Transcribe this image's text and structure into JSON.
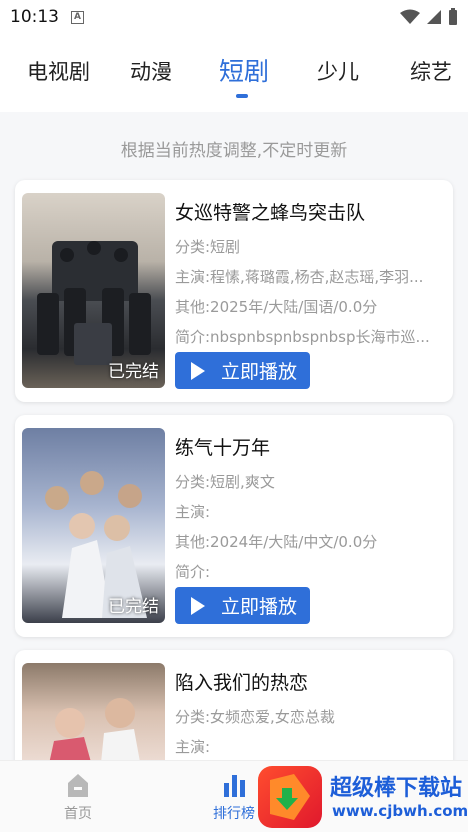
{
  "status_bar": {
    "time": "10:13",
    "notification_icon": "A",
    "icons": [
      "wifi-icon",
      "signal-icon",
      "battery-icon"
    ]
  },
  "tabs": [
    {
      "label": "电视剧",
      "active": false
    },
    {
      "label": "动漫",
      "active": false
    },
    {
      "label": "短剧",
      "active": true
    },
    {
      "label": "少儿",
      "active": false
    },
    {
      "label": "综艺",
      "active": false
    }
  ],
  "accent_color": "#2f6fd9",
  "hint": "根据当前热度调整,不定时更新",
  "items": [
    {
      "title": "女巡特警之蜂鸟突击队",
      "category": "分类:短剧",
      "cast": "主演:程愫,蒋璐霞,杨杏,赵志瑶,李羽...",
      "other": "其他:2025年/大陆/国语/0.0分",
      "intro": "简介:nbspnbspnbspnbsp长海市巡...",
      "status": "已完结",
      "play_label": "立即播放"
    },
    {
      "title": "练气十万年",
      "category": "分类:短剧,爽文",
      "cast": "主演:",
      "other": "其他:2024年/大陆/中文/0.0分",
      "intro": "简介:",
      "status": "已完结",
      "play_label": "立即播放"
    },
    {
      "title": "陷入我们的热恋",
      "category": "分类:女频恋爱,女恋总裁",
      "cast": "主演:"
    }
  ],
  "bottom_nav": [
    {
      "label": "首页",
      "icon": "home-icon",
      "active": false
    },
    {
      "label": "排行榜",
      "icon": "chart-icon",
      "active": true
    }
  ],
  "watermark": {
    "title": "超级棒下载站",
    "url": "www.cjbwh.com"
  }
}
